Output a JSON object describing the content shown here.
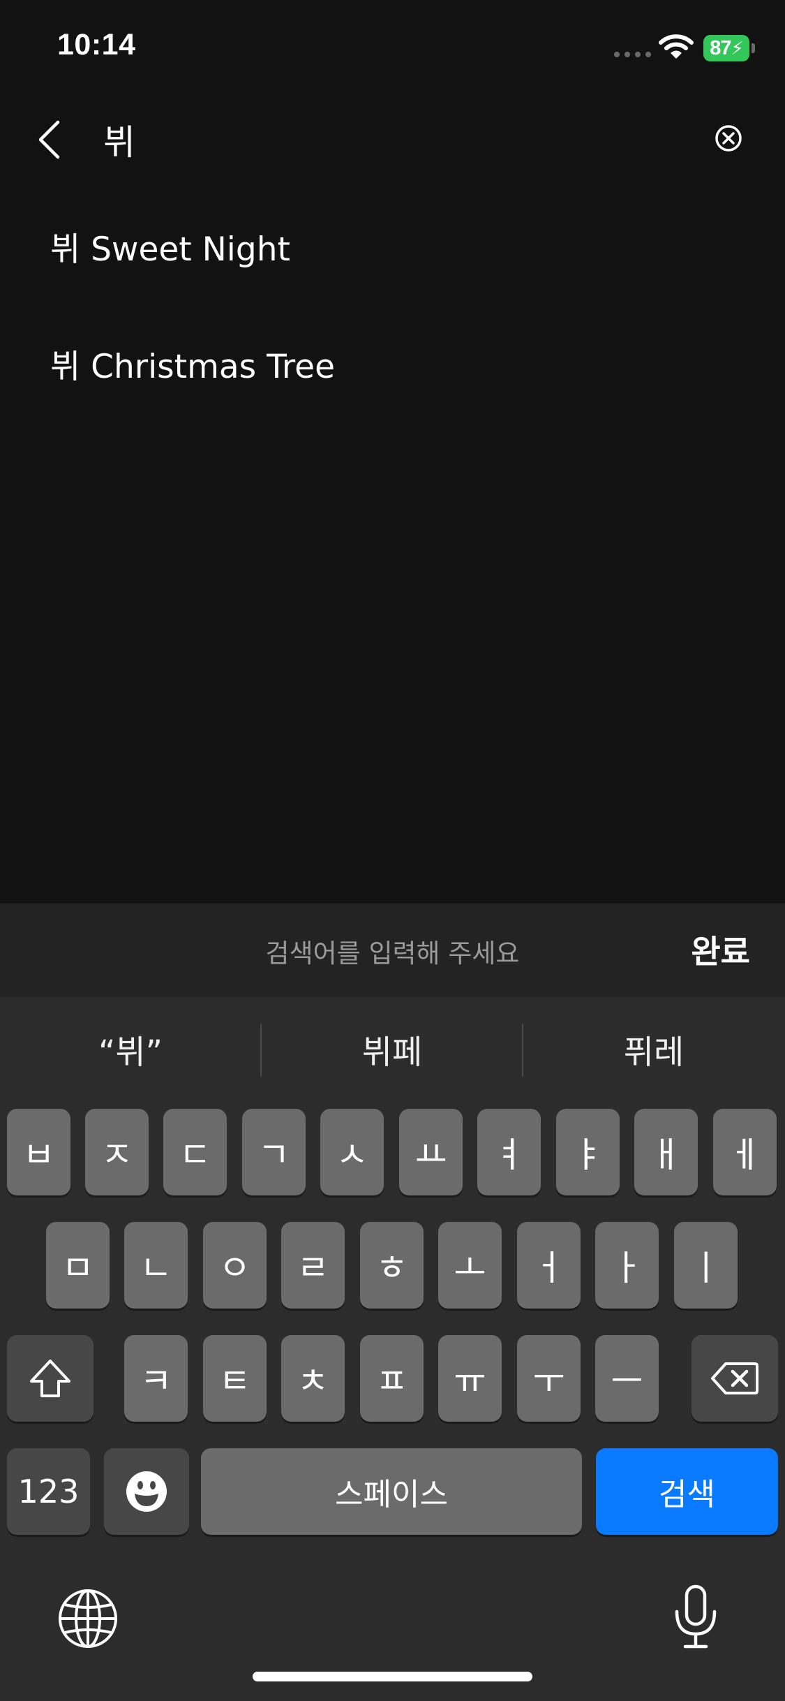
{
  "status_bar": {
    "time": "10:14",
    "battery": "87"
  },
  "search": {
    "query": "뷔"
  },
  "suggestions": [
    {
      "label": "뷔 Sweet Night"
    },
    {
      "label": "뷔 Christmas Tree"
    }
  ],
  "accessory": {
    "hint": "검색어를 입력해 주세요",
    "done_label": "완료"
  },
  "keyboard": {
    "predictions": [
      "“뷔”",
      "뷔페",
      "퓌레"
    ],
    "row1": [
      "ㅂ",
      "ㅈ",
      "ㄷ",
      "ㄱ",
      "ㅅ",
      "ㅛ",
      "ㅕ",
      "ㅑ",
      "ㅐ",
      "ㅔ"
    ],
    "row2": [
      "ㅁ",
      "ㄴ",
      "ㅇ",
      "ㄹ",
      "ㅎ",
      "ㅗ",
      "ㅓ",
      "ㅏ",
      "ㅣ"
    ],
    "row3": [
      "ㅋ",
      "ㅌ",
      "ㅊ",
      "ㅍ",
      "ㅠ",
      "ㅜ",
      "ㅡ"
    ],
    "numbers_label": "123",
    "space_label": "스페이스",
    "search_label": "검색"
  },
  "icons": [
    "back-chevron-icon",
    "clear-circle-x-icon",
    "wifi-icon",
    "shift-arrow-icon",
    "backspace-icon",
    "emoji-icon",
    "globe-icon",
    "microphone-icon"
  ]
}
